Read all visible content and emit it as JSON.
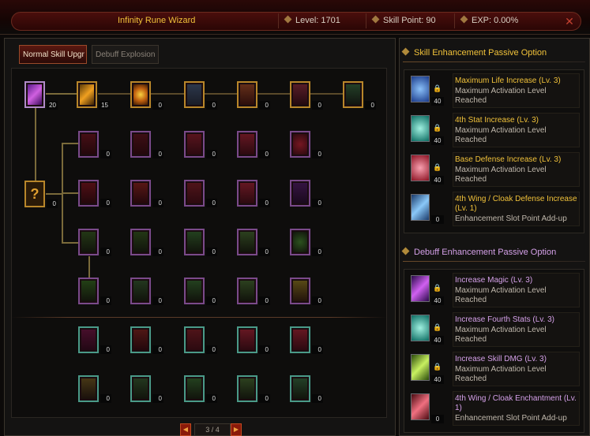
{
  "header": {
    "title": "Infinity Rune Wizard",
    "level": "Level: 1701",
    "skill_point": "Skill Point: 90",
    "exp": "EXP:  0.00%"
  },
  "tabs": [
    {
      "label": "Normal Skill Upgr",
      "active": true
    },
    {
      "label": "Debuff Explosion",
      "active": false
    }
  ],
  "tree": {
    "top_row": [
      "20",
      "15",
      "0",
      "0",
      "0",
      "0",
      "0"
    ],
    "locked_node": "0",
    "grid_rows": [
      [
        "0",
        "0",
        "0",
        "0",
        "0"
      ],
      [
        "0",
        "0",
        "0",
        "0",
        "0"
      ],
      [
        "0",
        "0",
        "0",
        "0",
        "0"
      ],
      [
        "0",
        "0",
        "0",
        "0",
        "0"
      ],
      [
        "0",
        "0",
        "0",
        "0",
        "0"
      ],
      [
        "0",
        "0",
        "0",
        "0",
        "0"
      ]
    ]
  },
  "pager": {
    "text": "3 / 4"
  },
  "skill_section": {
    "title": "Skill Enhancement Passive Option",
    "items": [
      {
        "name": "Maximum Life Increase (Lv. 3)",
        "desc": "Maximum Activation Level Reached",
        "level": "40",
        "icon": "life-icon",
        "color": "#3a7ad8"
      },
      {
        "name": "4th Stat Increase (Lv. 3)",
        "desc": "Maximum Activation Level Reached",
        "level": "40",
        "icon": "stat-icon",
        "color": "#2aa8a0"
      },
      {
        "name": "Base Defense Increase (Lv. 3)",
        "desc": "Maximum Activation Level Reached",
        "level": "40",
        "icon": "defense-icon",
        "color": "#c83040"
      },
      {
        "name": "4th Wing / Cloak Defense Increase (Lv. 1)",
        "desc": "Enhancement Slot Point Add-up",
        "level": "0",
        "icon": "wing-icon",
        "color": "#4a9ae0"
      }
    ]
  },
  "debuff_section": {
    "title": "Debuff Enhancement Passive Option",
    "items": [
      {
        "name": "Increase Magic (Lv. 3)",
        "desc": "Maximum Activation Level Reached",
        "level": "40",
        "icon": "staff-icon",
        "color": "#a838d8"
      },
      {
        "name": "Increase Fourth Stats (Lv. 3)",
        "desc": "Maximum Activation Level Reached",
        "level": "40",
        "icon": "stat-icon",
        "color": "#2aa8a0"
      },
      {
        "name": "Increase Skill DMG (Lv. 3)",
        "desc": "Maximum Activation Level Reached",
        "level": "40",
        "icon": "slash-icon",
        "color": "#8ac830"
      },
      {
        "name": "4th Wing / Cloak Enchantment (Lv. 1)",
        "desc": "Enhancement Slot Point Add-up",
        "level": "0",
        "icon": "wing-icon",
        "color": "#d83040"
      }
    ]
  }
}
